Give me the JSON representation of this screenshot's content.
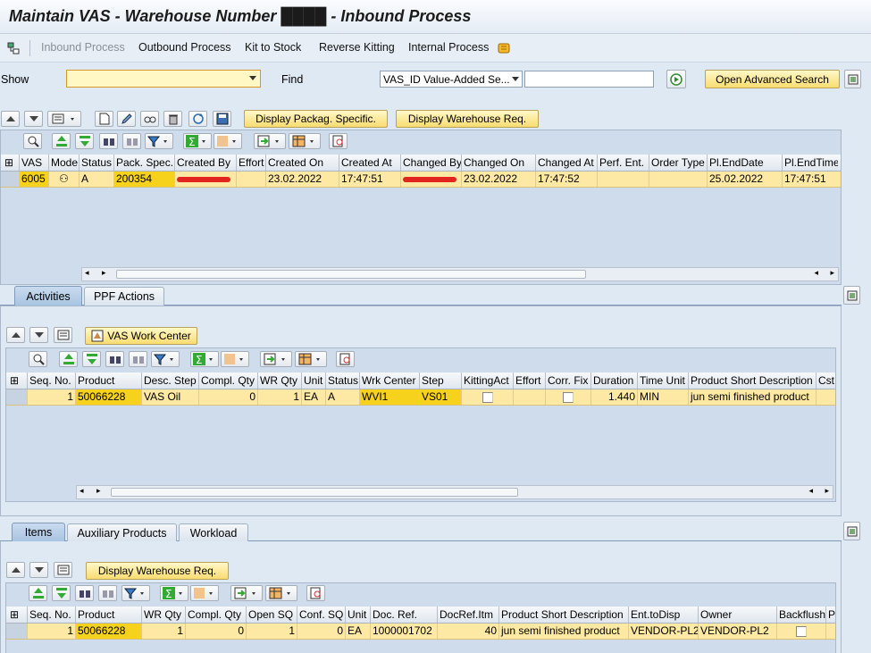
{
  "window": {
    "title": "Maintain VAS - Warehouse Number ████ - Inbound Process"
  },
  "menu": {
    "inbound": "Inbound Process",
    "outbound": "Outbound Process",
    "kit": "Kit to Stock",
    "reverse": "Reverse Kitting",
    "internal": "Internal Process"
  },
  "filter": {
    "show_label": "Show",
    "find_label": "Find",
    "find_select": "VAS_ID Value-Added Se...",
    "adv_search": "Open Advanced Search"
  },
  "top_toolbar": {
    "pack_spec_btn": "Display Packag. Specific.",
    "wh_req_btn": "Display Warehouse Req."
  },
  "vas_table": {
    "columns": [
      "VAS",
      "Mode",
      "Status",
      "Pack. Spec.",
      "Created By",
      "Effort",
      "Created On",
      "Created At",
      "Changed By",
      "Changed On",
      "Changed At",
      "Perf. Ent.",
      "Order Type",
      "Pl.EndDate",
      "Pl.EndTime"
    ],
    "row": {
      "vas": "6005",
      "mode": "",
      "status": "A",
      "pack": "200354",
      "created_by": "",
      "effort": "",
      "created_on": "23.02.2022",
      "created_at": "17:47:51",
      "changed_by": "",
      "changed_on": "23.02.2022",
      "changed_at": "17:47:52",
      "perf": "",
      "order": "",
      "plend_date": "25.02.2022",
      "plend_time": "17:47:51"
    }
  },
  "tabs1": {
    "activities": "Activities",
    "ppf": "PPF Actions"
  },
  "act_toolbar": {
    "work_center_btn": "VAS Work Center"
  },
  "act_table": {
    "columns": [
      "Seq. No.",
      "Product",
      "Desc. Step",
      "Compl. Qty",
      "WR Qty",
      "Unit",
      "Status",
      "Wrk Center",
      "Step",
      "KittingAct",
      "Effort",
      "Corr. Fix",
      "Duration",
      "Time Unit",
      "Product Short Description",
      "Cst"
    ],
    "row": {
      "seq": "1",
      "product": "50066228",
      "desc": "VAS Oil",
      "compl": "0",
      "wr": "1",
      "unit": "EA",
      "status": "A",
      "wc": "WVI1",
      "step": "VS01",
      "effort": "",
      "duration": "1.440",
      "tunit": "MIN",
      "psd": "jun semi finished product"
    }
  },
  "tabs2": {
    "items": "Items",
    "aux": "Auxiliary Products",
    "workload": "Workload"
  },
  "items_toolbar": {
    "wh_req_btn": "Display Warehouse Req."
  },
  "items_table": {
    "columns": [
      "Seq. No.",
      "Product",
      "WR Qty",
      "Compl. Qty",
      "Open SQ",
      "Conf. SQ",
      "Unit",
      "Doc. Ref.",
      "DocRef.Itm",
      "Product Short Description",
      "Ent.toDisp",
      "Owner",
      "Backflush",
      "Pc"
    ],
    "row": {
      "seq": "1",
      "product": "50066228",
      "wr": "1",
      "compl": "0",
      "open": "1",
      "conf": "0",
      "unit": "EA",
      "docref": "1000001702",
      "docitm": "40",
      "psd": "jun semi finished product",
      "ent": "VENDOR-PL2",
      "owner": "VENDOR-PL2"
    }
  }
}
